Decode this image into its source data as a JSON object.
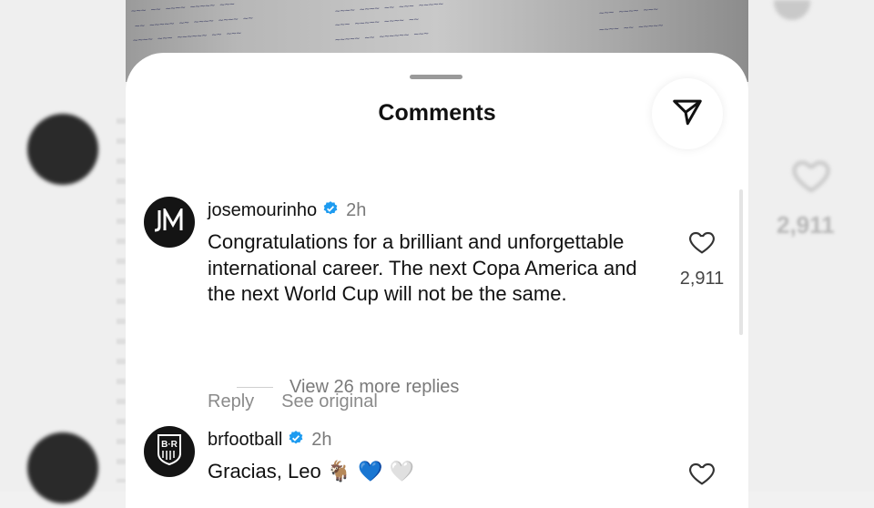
{
  "sheet": {
    "title": "Comments"
  },
  "comments": [
    {
      "username": "josemourinho",
      "time": "2h",
      "text": "Congratulations for a brilliant and unforgettable international career. The next Copa America and the next World Cup will not be the same.",
      "likes": "2,911",
      "reply_label": "Reply",
      "see_original_label": "See original",
      "view_replies_label": "View 26 more replies"
    },
    {
      "username": "brfootball",
      "time": "2h",
      "text": "Gracias, Leo",
      "emojis": "🐐 💙 🤍"
    }
  ],
  "background": {
    "right_like_count": "2,911"
  },
  "colors": {
    "verified": "#1d9bf0",
    "muted_text": "#8a8a8a"
  }
}
